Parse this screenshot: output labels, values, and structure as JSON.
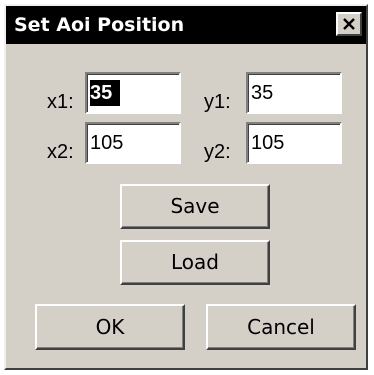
{
  "dialog": {
    "title": "Set Aoi Position",
    "close_icon": "close-x-icon"
  },
  "fields": {
    "x1": {
      "label": "x1:",
      "value": "35"
    },
    "y1": {
      "label": "y1:",
      "value": "35"
    },
    "x2": {
      "label": "x2:",
      "value": "105"
    },
    "y2": {
      "label": "y2:",
      "value": "105"
    }
  },
  "buttons": {
    "save": "Save",
    "load": "Load",
    "ok": "OK",
    "cancel": "Cancel"
  },
  "colors": {
    "dialog_face": "#d4d0c8",
    "titlebar": "#000000",
    "title_text": "#ffffff",
    "selection": "#000000"
  }
}
